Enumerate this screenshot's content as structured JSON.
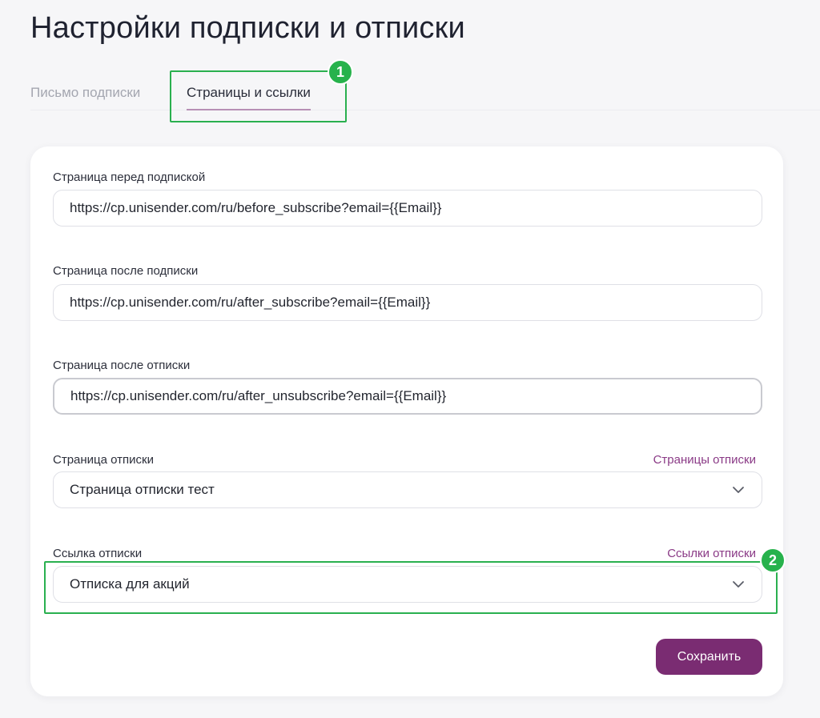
{
  "page": {
    "title": "Настройки подписки и отписки"
  },
  "tabs": [
    {
      "label": "Письмо подписки",
      "active": false
    },
    {
      "label": "Страницы и ссылки",
      "active": true
    }
  ],
  "form": {
    "before_subscribe": {
      "label": "Страница перед подпиской",
      "value": "https://cp.unisender.com/ru/before_subscribe?email={{Email}}"
    },
    "after_subscribe": {
      "label": "Страница после подписки",
      "value": "https://cp.unisender.com/ru/after_subscribe?email={{Email}}"
    },
    "after_unsubscribe": {
      "label": "Страница после отписки",
      "value": "https://cp.unisender.com/ru/after_unsubscribe?email={{Email}}"
    },
    "unsubscribe_page": {
      "label": "Страница отписки",
      "link": "Страницы отписки",
      "value": "Страница отписки тест"
    },
    "unsubscribe_link": {
      "label": "Ссылка отписки",
      "link": "Ссылки отписки",
      "value": "Отписка для акций"
    },
    "save_label": "Сохранить"
  },
  "annotations": {
    "badge_1": "1",
    "badge_2": "2"
  },
  "icons": {
    "dropdown": "chevron-down-icon"
  },
  "colors": {
    "accent": "#7a2c72",
    "link": "#8a3a86",
    "highlight": "#2ab04f",
    "tab_underline": "#b78fb5"
  }
}
